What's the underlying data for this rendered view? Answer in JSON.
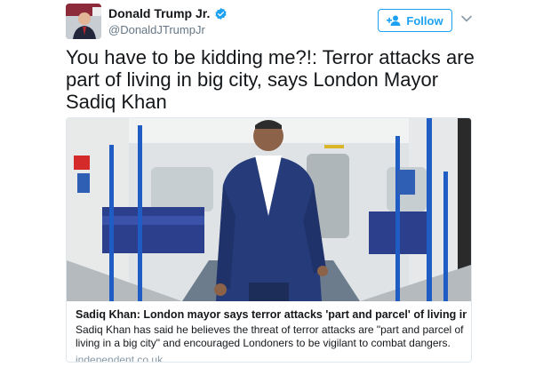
{
  "author": {
    "name": "Donald Trump Jr.",
    "handle": "@DonaldJTrumpJr",
    "verified_icon": "verified-badge-icon"
  },
  "actions": {
    "follow_label": "Follow",
    "follow_icon": "add-user-icon",
    "menu_icon": "chevron-down-icon"
  },
  "tweet": {
    "text": "You have to be kidding me?!: Terror attacks are part of living in big city, says London Mayor Sadiq Khan"
  },
  "card": {
    "title": "Sadiq Khan: London mayor says terror attacks 'part and parcel' of living in ...",
    "description": "Sadiq Khan has said he believes the threat of terror attacks are \"part and parcel of living in a big city\" and encouraged Londoners to be vigilant to combat dangers.",
    "domain": "independent.co.uk"
  },
  "colors": {
    "accent": "#1da1f2",
    "muted": "#657786",
    "border": "#e1e8ed"
  }
}
